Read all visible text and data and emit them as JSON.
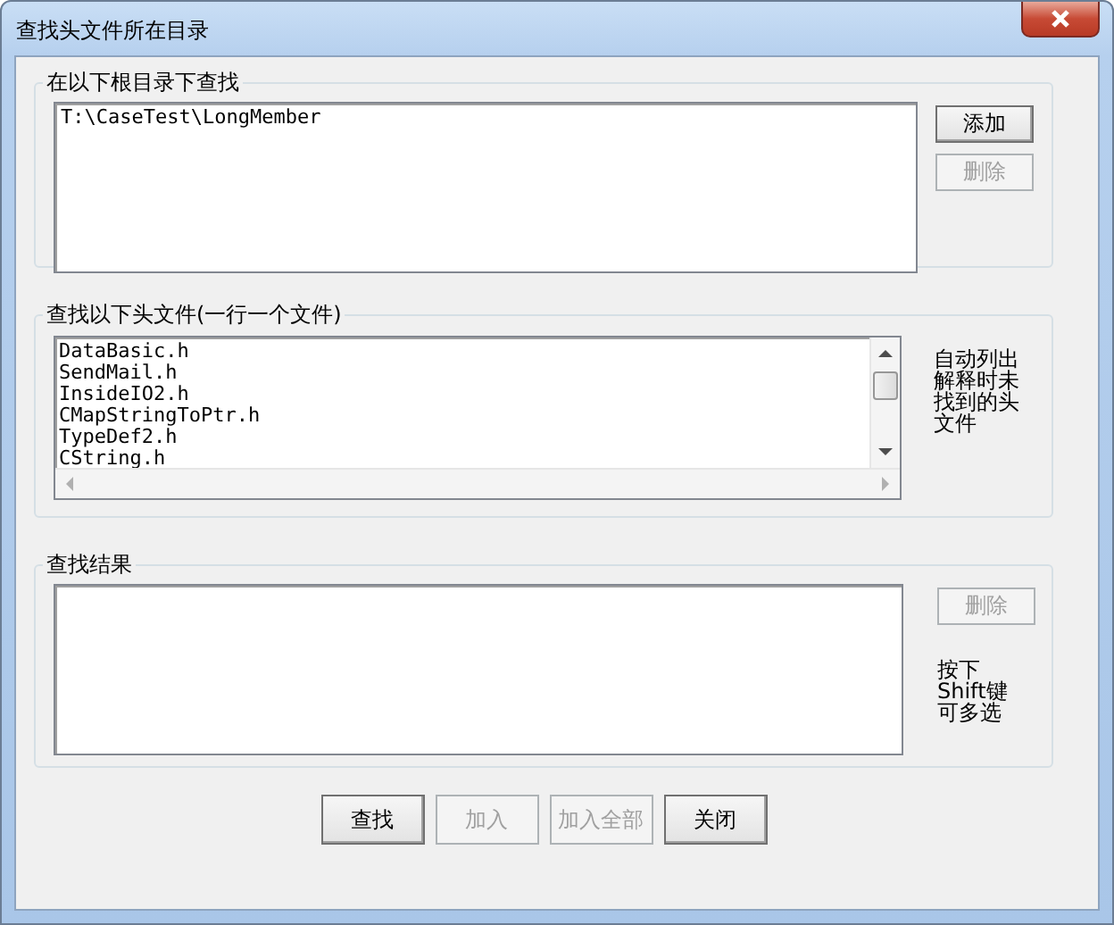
{
  "window": {
    "title": "查找头文件所在目录"
  },
  "root_group": {
    "label": "在以下根目录下查找",
    "value": "T:\\CaseTest\\LongMember",
    "buttons": [
      {
        "label": "添加",
        "disabled": false
      },
      {
        "label": "删除",
        "disabled": true
      }
    ]
  },
  "headers_group": {
    "label": "查找以下头文件(一行一个文件)",
    "files": [
      "DataBasic.h",
      "SendMail.h",
      "InsideIO2.h",
      "CMapStringToPtr.h",
      "TypeDef2.h",
      "CString.h"
    ],
    "note": "自动列出解释时未找到的头文件"
  },
  "results_group": {
    "label": "查找结果",
    "buttons": [
      {
        "label": "删除",
        "disabled": true
      }
    ],
    "note": "按下Shift键可多选"
  },
  "buttons": [
    {
      "label": "查找",
      "disabled": false
    },
    {
      "label": "加入",
      "disabled": true
    },
    {
      "label": "加入全部",
      "disabled": true
    },
    {
      "label": "关闭",
      "disabled": false
    }
  ]
}
